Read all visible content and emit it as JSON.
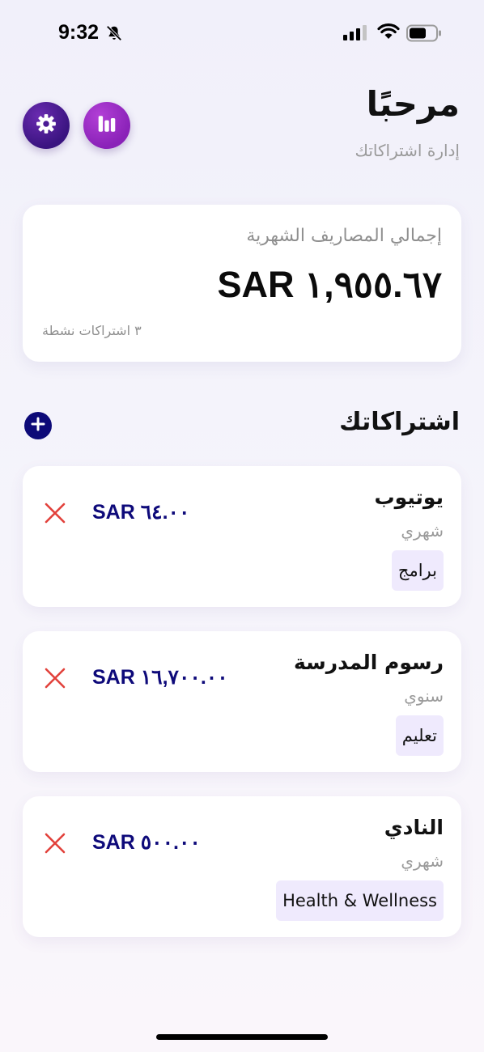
{
  "status_bar": {
    "time": "9:32",
    "icons": [
      "bell-slash-icon",
      "signal-icon",
      "wifi-icon",
      "battery-icon"
    ]
  },
  "header": {
    "title": "مرحبًا",
    "subtitle": "إدارة اشتراكاتك",
    "settings_icon": "gear-icon",
    "stats_icon": "bar-chart-icon"
  },
  "summary": {
    "label": "إجمالي المصاريف الشهرية",
    "total": "SAR ١,٩٥٥.٦٧",
    "active_count": "٣ اشتراكات نشطة"
  },
  "subscriptions_section": {
    "title": "اشتراكاتك",
    "add_icon": "plus-icon"
  },
  "subscriptions": [
    {
      "name": "يوتيوب",
      "cycle": "شهري",
      "category": "برامج",
      "price": "SAR ٦٤.٠٠"
    },
    {
      "name": "رسوم المدرسة",
      "cycle": "سنوي",
      "category": "تعليم",
      "price": "SAR ١٦,٧٠٠.٠٠"
    },
    {
      "name": "النادي",
      "cycle": "شهري",
      "category": "Health & Wellness",
      "price": "SAR ٥٠٠.٠٠"
    }
  ],
  "colors": {
    "accent_dark": "#0d0a78",
    "settings_button": "#4a1a95",
    "stats_button": "#9b2cc6",
    "delete": "#e2413b",
    "category_bg": "#efeafd"
  }
}
